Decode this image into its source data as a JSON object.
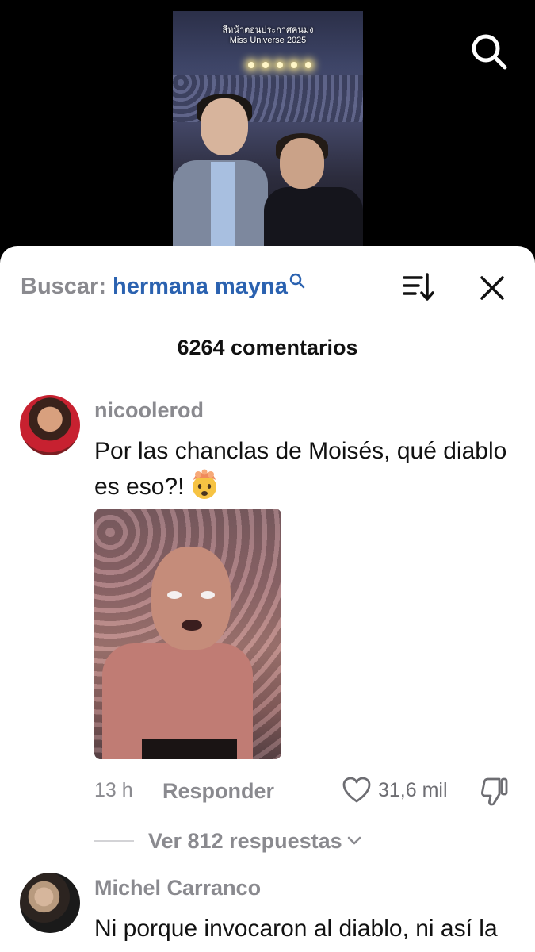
{
  "video": {
    "caption_line1": "สีหน้าตอนประกาศคนมง",
    "caption_line2": "Miss Universe 2025"
  },
  "sheet": {
    "search_prefix": "Buscar:",
    "search_query": "hermana mayna",
    "comment_count": "6264 comentarios"
  },
  "comments": [
    {
      "username": "nicoolerod",
      "text": "Por las chanclas de Moisés, qué diablo es eso?!",
      "emoji": "exploding-head",
      "time": "13 h",
      "reply_label": "Responder",
      "likes": "31,6 mil",
      "view_replies": "Ver 812 respuestas"
    },
    {
      "username": "Michel Carranco",
      "text": "Ni porque invocaron al diablo, ni así la ha..."
    }
  ],
  "icons": [
    "search-icon",
    "sort-icon",
    "close-icon",
    "heart-icon",
    "thumbs-down-icon",
    "chevron-down-icon"
  ],
  "colors": {
    "accent": "#2b62b0",
    "muted": "#8a8a8f",
    "text": "#111111",
    "sheet_bg": "#ffffff",
    "top_bg": "#000000"
  }
}
